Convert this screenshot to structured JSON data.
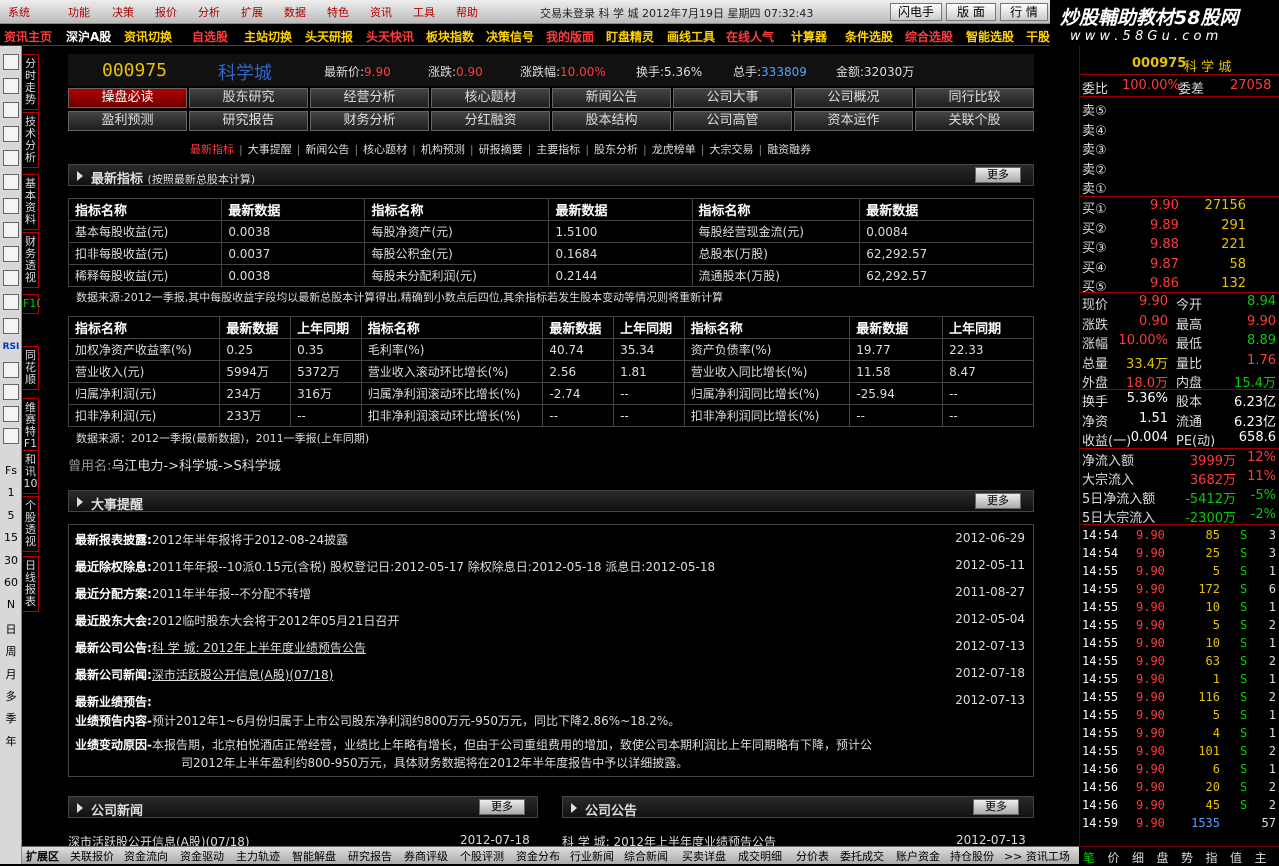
{
  "menu": {
    "items": [
      "系统",
      "功能",
      "决策",
      "报价",
      "分析",
      "扩展",
      "数据",
      "特色",
      "资讯",
      "工具",
      "帮助"
    ],
    "status": "交易未登录 科 学 城 2012年7月19日 星期四 07:32:43",
    "buttons": [
      "闪电手",
      "版 面",
      "行 情"
    ]
  },
  "brand": {
    "line1": "炒股輔助教材58股网",
    "line2": "w w w . 5 8 G u . c o m"
  },
  "quickbar": [
    "资讯主页",
    "深沪A股",
    "资讯切换",
    "自选股",
    "主站切换",
    "头天研报",
    "头天快讯",
    "板块指数",
    "决策信号",
    "我的版面",
    "盯盘精灵",
    "画线工具",
    "在线人气",
    "计算器",
    "条件选股",
    "综合选股",
    "智能选股",
    "干股"
  ],
  "left_toolbar": {
    "icons": [
      "layout-icon",
      "quote-icon",
      "list-icon",
      "kline-icon",
      "table-icon",
      "f10-icon",
      "news-icon",
      "note-icon",
      "f1-icon",
      "grid-icon",
      "web-icon",
      "wave-icon"
    ],
    "rsi": "RSI",
    "labels": [
      "Fs",
      "1",
      "5",
      "15",
      "30",
      "60",
      "N",
      "日",
      "周",
      "月",
      "多",
      "季",
      "年"
    ]
  },
  "vtabs": [
    "分时走势",
    "技术分析",
    "基本资料",
    "财务透视",
    "F10",
    "同花顺",
    "维赛特F1",
    "和讯10",
    "个股透视",
    "日线报表"
  ],
  "header": {
    "code": "000975",
    "name": "科学城",
    "fields": [
      {
        "label": "最新价:",
        "value": "9.90",
        "color": "red"
      },
      {
        "label": "涨跌:",
        "value": "0.90",
        "color": "red"
      },
      {
        "label": "涨跌幅:",
        "value": "10.00%",
        "color": "red"
      },
      {
        "label": "换手:",
        "value": "5.36%",
        "color": "white"
      },
      {
        "label": "总手:",
        "value": "333809",
        "color": "blue"
      },
      {
        "label": "金额:",
        "value": "32030万",
        "color": "white"
      }
    ]
  },
  "tabs": {
    "row1": [
      "操盘必读",
      "股东研究",
      "经营分析",
      "核心题材",
      "新闻公告",
      "公司大事",
      "公司概况",
      "同行比较"
    ],
    "row2": [
      "盈利预测",
      "研究报告",
      "财务分析",
      "分红融资",
      "股本结构",
      "公司高管",
      "资本运作",
      "关联个股"
    ]
  },
  "sublinks": [
    "最新指标",
    "大事提醒",
    "新闻公告",
    "核心题材",
    "机构预测",
    "研报摘要",
    "主要指标",
    "股东分析",
    "龙虎榜单",
    "大宗交易",
    "融资融券"
  ],
  "section1": {
    "title": "最新指标",
    "sub": "(按照最新总股本计算)",
    "more": "更多"
  },
  "table1": {
    "header": [
      "指标名称",
      "最新数据",
      "指标名称",
      "最新数据",
      "指标名称",
      "最新数据"
    ],
    "rows": [
      [
        "基本每股收益(元)",
        "0.0038",
        "每股净资产(元)",
        "1.5100",
        "每股经营现金流(元)",
        "0.0084"
      ],
      [
        "扣非每股收益(元)",
        "0.0037",
        "每股公积金(元)",
        "0.1684",
        "总股本(万股)",
        "62,292.57"
      ],
      [
        "稀释每股收益(元)",
        "0.0038",
        "每股未分配利润(元)",
        "0.2144",
        "流通股本(万股)",
        "62,292.57"
      ]
    ],
    "note": "数据来源:2012一季报,其中每股收益字段均以最新总股本计算得出,精确到小数点后四位,其余指标若发生股本变动等情况则将重新计算"
  },
  "table2": {
    "header": [
      "指标名称",
      "最新数据",
      "上年同期",
      "指标名称",
      "最新数据",
      "上年同期",
      "指标名称",
      "最新数据",
      "上年同期"
    ],
    "rows": [
      [
        "加权净资产收益率(%)",
        "0.25",
        "0.35",
        "毛利率(%)",
        "40.74",
        "35.34",
        "资产负债率(%)",
        "19.77",
        "22.33"
      ],
      [
        "营业收入(元)",
        "5994万",
        "5372万",
        "营业收入滚动环比增长(%)",
        "2.56",
        "1.81",
        "营业收入同比增长(%)",
        "11.58",
        "8.47"
      ],
      [
        "归属净利润(元)",
        "234万",
        "316万",
        "归属净利润滚动环比增长(%)",
        "-2.74",
        "--",
        "归属净利润同比增长(%)",
        "-25.94",
        "--"
      ],
      [
        "扣非净利润(元)",
        "233万",
        "--",
        "扣非净利润滚动环比增长(%)",
        "--",
        "--",
        "扣非净利润同比增长(%)",
        "--",
        "--"
      ]
    ],
    "note": "数据来源：2012一季报(最新数据)，2011一季报(上年同期)"
  },
  "former_name": {
    "label": "曾用名:",
    "value": "乌江电力->科学城->S科学城"
  },
  "section2": {
    "title": "大事提醒",
    "more": "更多"
  },
  "events": [
    {
      "k": "最新报表披露:",
      "v": "2012年半年报将于2012-08-24披露",
      "d": "2012-06-29",
      "link": false
    },
    {
      "k": "最近除权除息:",
      "v": "2011年年报--10派0.15元(含税) 股权登记日:2012-05-17 除权除息日:2012-05-18 派息日:2012-05-18",
      "d": "2012-05-11",
      "link": false
    },
    {
      "k": "最近分配方案:",
      "v": "2011年半年报--不分配不转增",
      "d": "2011-08-27",
      "link": false
    },
    {
      "k": "最近股东大会:",
      "v": "2012临时股东大会将于2012年05月21日召开",
      "d": "2012-05-04",
      "link": false
    },
    {
      "k": "最新公司公告:",
      "v": "科 学 城: 2012年上半年度业绩预告公告",
      "d": "2012-07-13",
      "link": true
    },
    {
      "k": "最新公司新闻:",
      "v": "深市活跃股公开信息(A股)(07/18)",
      "d": "2012-07-18",
      "link": true
    },
    {
      "k": "最新业绩预告:",
      "v": "",
      "d": "2012-07-13",
      "link": false
    }
  ],
  "forecast": {
    "k1": "业绩预告内容-",
    "v1": "预计2012年1~6月份归属于上市公司股东净利润约800万元-950万元，同比下降2.86%~18.2%。",
    "k2": "业绩变动原因-",
    "v2a": "本报告期，北京柏悦酒店正常经营，业绩比上年略有增长，但由于公司重组费用的增加，致使公司本期利润比上年同期略有下降，预计公",
    "v2b": "司2012年上半年盈利约800-950万元，具体财务数据将在2012年半年度报告中予以详细披露。"
  },
  "section3": {
    "title": "公司新闻",
    "more": "更多"
  },
  "section4": {
    "title": "公司公告",
    "more": "更多"
  },
  "news_peek": {
    "left": "深市活跃股公开信息(A股)(07/18)",
    "left_date": "2012-07-18",
    "right": "科 学 城: 2012年上半年度业绩预告公告",
    "right_date": "2012-07-13"
  },
  "bottom_tabs": [
    "扩展区",
    "关联报价",
    "资金流向",
    "资金驱动",
    "主力轨迹",
    "智能解盘",
    "研究报告",
    "券商评级",
    "个股评测",
    "资金分布",
    "行业新闻",
    "综合新闻",
    "买卖详盘",
    "成交明细",
    "分价表",
    "委托成交",
    "账户资金",
    "持仓股份",
    ">> 资讯工场"
  ],
  "right_panel": {
    "code": "000975",
    "name": "科 学 城",
    "weibi": {
      "label1": "委比",
      "v1": "100.00%",
      "label2": "委差",
      "v2": "27058"
    },
    "sells": [
      "卖⑤",
      "卖④",
      "卖③",
      "卖②",
      "卖①"
    ],
    "buys": [
      {
        "l": "买①",
        "p": "9.90",
        "v": "27156"
      },
      {
        "l": "买②",
        "p": "9.89",
        "v": "291"
      },
      {
        "l": "买③",
        "p": "9.88",
        "v": "221"
      },
      {
        "l": "买④",
        "p": "9.87",
        "v": "58"
      },
      {
        "l": "买⑤",
        "p": "9.86",
        "v": "132"
      }
    ],
    "stats": [
      {
        "l1": "现价",
        "v1": "9.90",
        "c1": "red",
        "l2": "今开",
        "v2": "8.94",
        "c2": "green"
      },
      {
        "l1": "涨跌",
        "v1": "0.90",
        "c1": "red",
        "l2": "最高",
        "v2": "9.90",
        "c2": "red"
      },
      {
        "l1": "涨幅",
        "v1": "10.00%",
        "c1": "red",
        "l2": "最低",
        "v2": "8.89",
        "c2": "green"
      },
      {
        "l1": "总量",
        "v1": "33.4万",
        "c1": "yellow",
        "l2": "量比",
        "v2": "1.76",
        "c2": "red"
      },
      {
        "l1": "外盘",
        "v1": "18.0万",
        "c1": "red",
        "l2": "内盘",
        "v2": "15.4万",
        "c2": "green"
      }
    ],
    "stats2": [
      {
        "l1": "换手",
        "v1": "5.36%",
        "l2": "股本",
        "v2": "6.23亿"
      },
      {
        "l1": "净资",
        "v1": "1.51",
        "l2": "流通",
        "v2": "6.23亿"
      },
      {
        "l1": "收益(一)",
        "v1": "0.004",
        "l2": "PE(动)",
        "v2": "658.6"
      }
    ],
    "flows": [
      {
        "l": "净流入额",
        "v": "3999万",
        "p": "12%",
        "c": "red"
      },
      {
        "l": "大宗流入",
        "v": "3682万",
        "p": "11%",
        "c": "red"
      },
      {
        "l": "5日净流入额",
        "v": "-5412万",
        "p": "-5%",
        "c": "green"
      },
      {
        "l": "5日大宗流入",
        "v": "-2300万",
        "p": "-2%",
        "c": "green"
      }
    ],
    "ticks": [
      [
        "14:54",
        "9.90",
        "85",
        "S",
        "3"
      ],
      [
        "14:54",
        "9.90",
        "25",
        "S",
        "3"
      ],
      [
        "14:55",
        "9.90",
        "5",
        "S",
        "1"
      ],
      [
        "14:55",
        "9.90",
        "172",
        "S",
        "6"
      ],
      [
        "14:55",
        "9.90",
        "10",
        "S",
        "1"
      ],
      [
        "14:55",
        "9.90",
        "5",
        "S",
        "2"
      ],
      [
        "14:55",
        "9.90",
        "10",
        "S",
        "1"
      ],
      [
        "14:55",
        "9.90",
        "63",
        "S",
        "2"
      ],
      [
        "14:55",
        "9.90",
        "1",
        "S",
        "1"
      ],
      [
        "14:55",
        "9.90",
        "116",
        "S",
        "2"
      ],
      [
        "14:55",
        "9.90",
        "5",
        "S",
        "1"
      ],
      [
        "14:55",
        "9.90",
        "4",
        "S",
        "1"
      ],
      [
        "14:55",
        "9.90",
        "101",
        "S",
        "2"
      ],
      [
        "14:56",
        "9.90",
        "6",
        "S",
        "1"
      ],
      [
        "14:56",
        "9.90",
        "20",
        "S",
        "2"
      ],
      [
        "14:56",
        "9.90",
        "45",
        "S",
        "2"
      ],
      [
        "14:59",
        "9.90",
        "1535",
        "",
        ""
      ]
    ],
    "last_tick_extra": "57",
    "bottom": [
      "笔",
      "价",
      "细",
      "盘",
      "势",
      "指",
      "值",
      "主"
    ]
  }
}
